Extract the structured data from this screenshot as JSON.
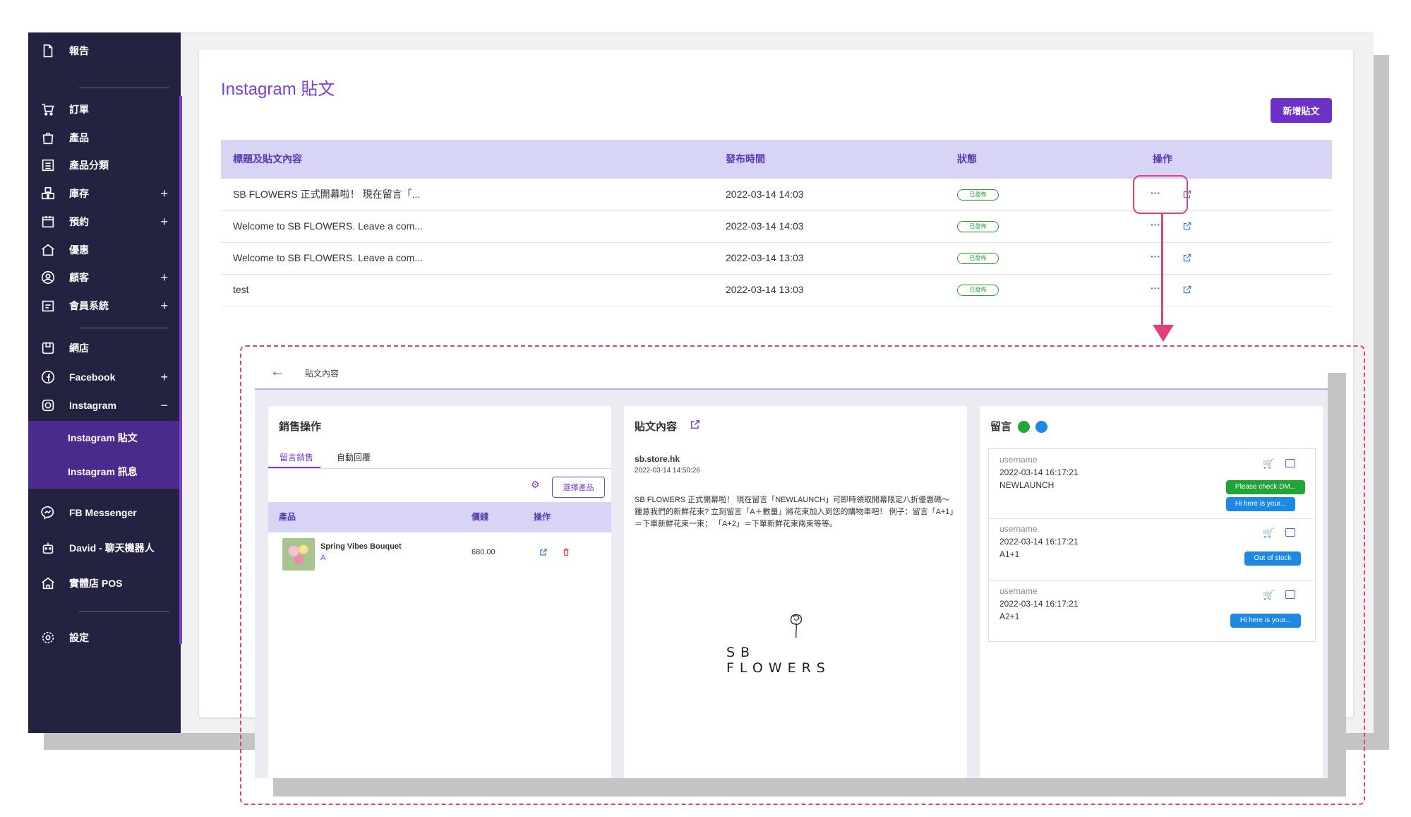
{
  "sidebar": {
    "items": [
      {
        "label": "報告",
        "icon": "file-icon"
      },
      {
        "label": "訂單",
        "icon": "cart-icon"
      },
      {
        "label": "產品",
        "icon": "bag-icon"
      },
      {
        "label": "產品分類",
        "icon": "list-icon"
      },
      {
        "label": "庫存",
        "icon": "boxes-icon",
        "expand": "+"
      },
      {
        "label": "預約",
        "icon": "calendar-icon",
        "expand": "+"
      },
      {
        "label": "優惠",
        "icon": "home-tag-icon"
      },
      {
        "label": "顧客",
        "icon": "user-circle-icon",
        "expand": "+"
      },
      {
        "label": "會員系統",
        "icon": "member-card-icon",
        "expand": "+"
      },
      {
        "label": "網店",
        "icon": "store-icon"
      },
      {
        "label": "Facebook",
        "icon": "facebook-icon",
        "expand": "+"
      },
      {
        "label": "Instagram",
        "icon": "instagram-icon",
        "expand": "−"
      },
      {
        "label": "FB Messenger",
        "icon": "messenger-icon"
      },
      {
        "label": "David - 聊天機器人",
        "icon": "robot-icon"
      },
      {
        "label": "實體店 POS",
        "icon": "pos-icon"
      },
      {
        "label": "設定",
        "icon": "settings-icon"
      }
    ],
    "subitems": [
      "Instagram 貼文",
      "Instagram 訊息"
    ]
  },
  "main": {
    "title": "Instagram 貼文",
    "new_button": "新增貼文",
    "columns": [
      "標題及貼文內容",
      "發布時間",
      "狀態",
      "操作"
    ],
    "rows": [
      {
        "content": "SB FLOWERS 正式開幕啦！ 現在留言「...",
        "time": "2022-03-14 14:03",
        "status": "已發佈",
        "action_more": "···"
      },
      {
        "content": "Welcome to SB FLOWERS. Leave a com...",
        "time": "2022-03-14 14:03",
        "status": "已發佈",
        "action_more": "···"
      },
      {
        "content": "Welcome to SB FLOWERS. Leave a com...",
        "time": "2022-03-14 13:03",
        "status": "已發佈",
        "action_more": "···"
      },
      {
        "content": "test",
        "time": "2022-03-14 13:03",
        "status": "已發佈",
        "action_more": "···"
      }
    ]
  },
  "detail": {
    "back_icon": "←",
    "title": "貼文內容",
    "sales": {
      "title": "銷售操作",
      "tabs": [
        "留言銷售",
        "自動回覆"
      ],
      "select_button": "選擇產品",
      "gear_icon": "⚙",
      "columns": [
        "產品",
        "價錢",
        "操作"
      ],
      "products": [
        {
          "name": "Spring Vibes Bouquet",
          "variant": "A",
          "price": "680.00"
        }
      ]
    },
    "post": {
      "title": "貼文內容",
      "username": "sb.store.hk",
      "time": "2022-03-14 14:50:26",
      "body": "SB FLOWERS 正式開幕啦！ 現在留言「NEWLAUNCH」可即時領取開幕限定八折優惠碼～ 鍾意我們的新鮮花束? 立刻留言「A＋數量」將花束加入到您的購物車吧！ 例子：留言「A+1」＝下單新鮮花束一束； 「A+2」＝下單新鮮花束兩束等等。",
      "logo_text": "SB FLOWERS"
    },
    "comments": {
      "title": "留言",
      "dot_colors": [
        "#22a63a",
        "#1e88e5"
      ],
      "items": [
        {
          "username": "username",
          "time": "2022-03-14 16:17:21",
          "text": "NEWLAUNCH",
          "replies": [
            {
              "label": "Please check DM...",
              "color": "#21a338"
            },
            {
              "label": "Hi here is your...",
              "color": "#1e88e5"
            }
          ]
        },
        {
          "username": "username",
          "time": "2022-03-14 16:17:21",
          "text": "A1+1",
          "replies": [
            {
              "label": "Out of stock",
              "color": "#1e88e5"
            }
          ]
        },
        {
          "username": "username",
          "time": "2022-03-14 16:17:21",
          "text": "A2+1",
          "replies": [
            {
              "label": "Hi here is your...",
              "color": "#1e88e5"
            }
          ]
        }
      ]
    }
  },
  "colors": {
    "accent": "#7b3fd6",
    "sidebar_bg": "#232241",
    "highlight": "#e0407a",
    "status_green": "#26a232",
    "link_blue": "#3a70d6"
  }
}
